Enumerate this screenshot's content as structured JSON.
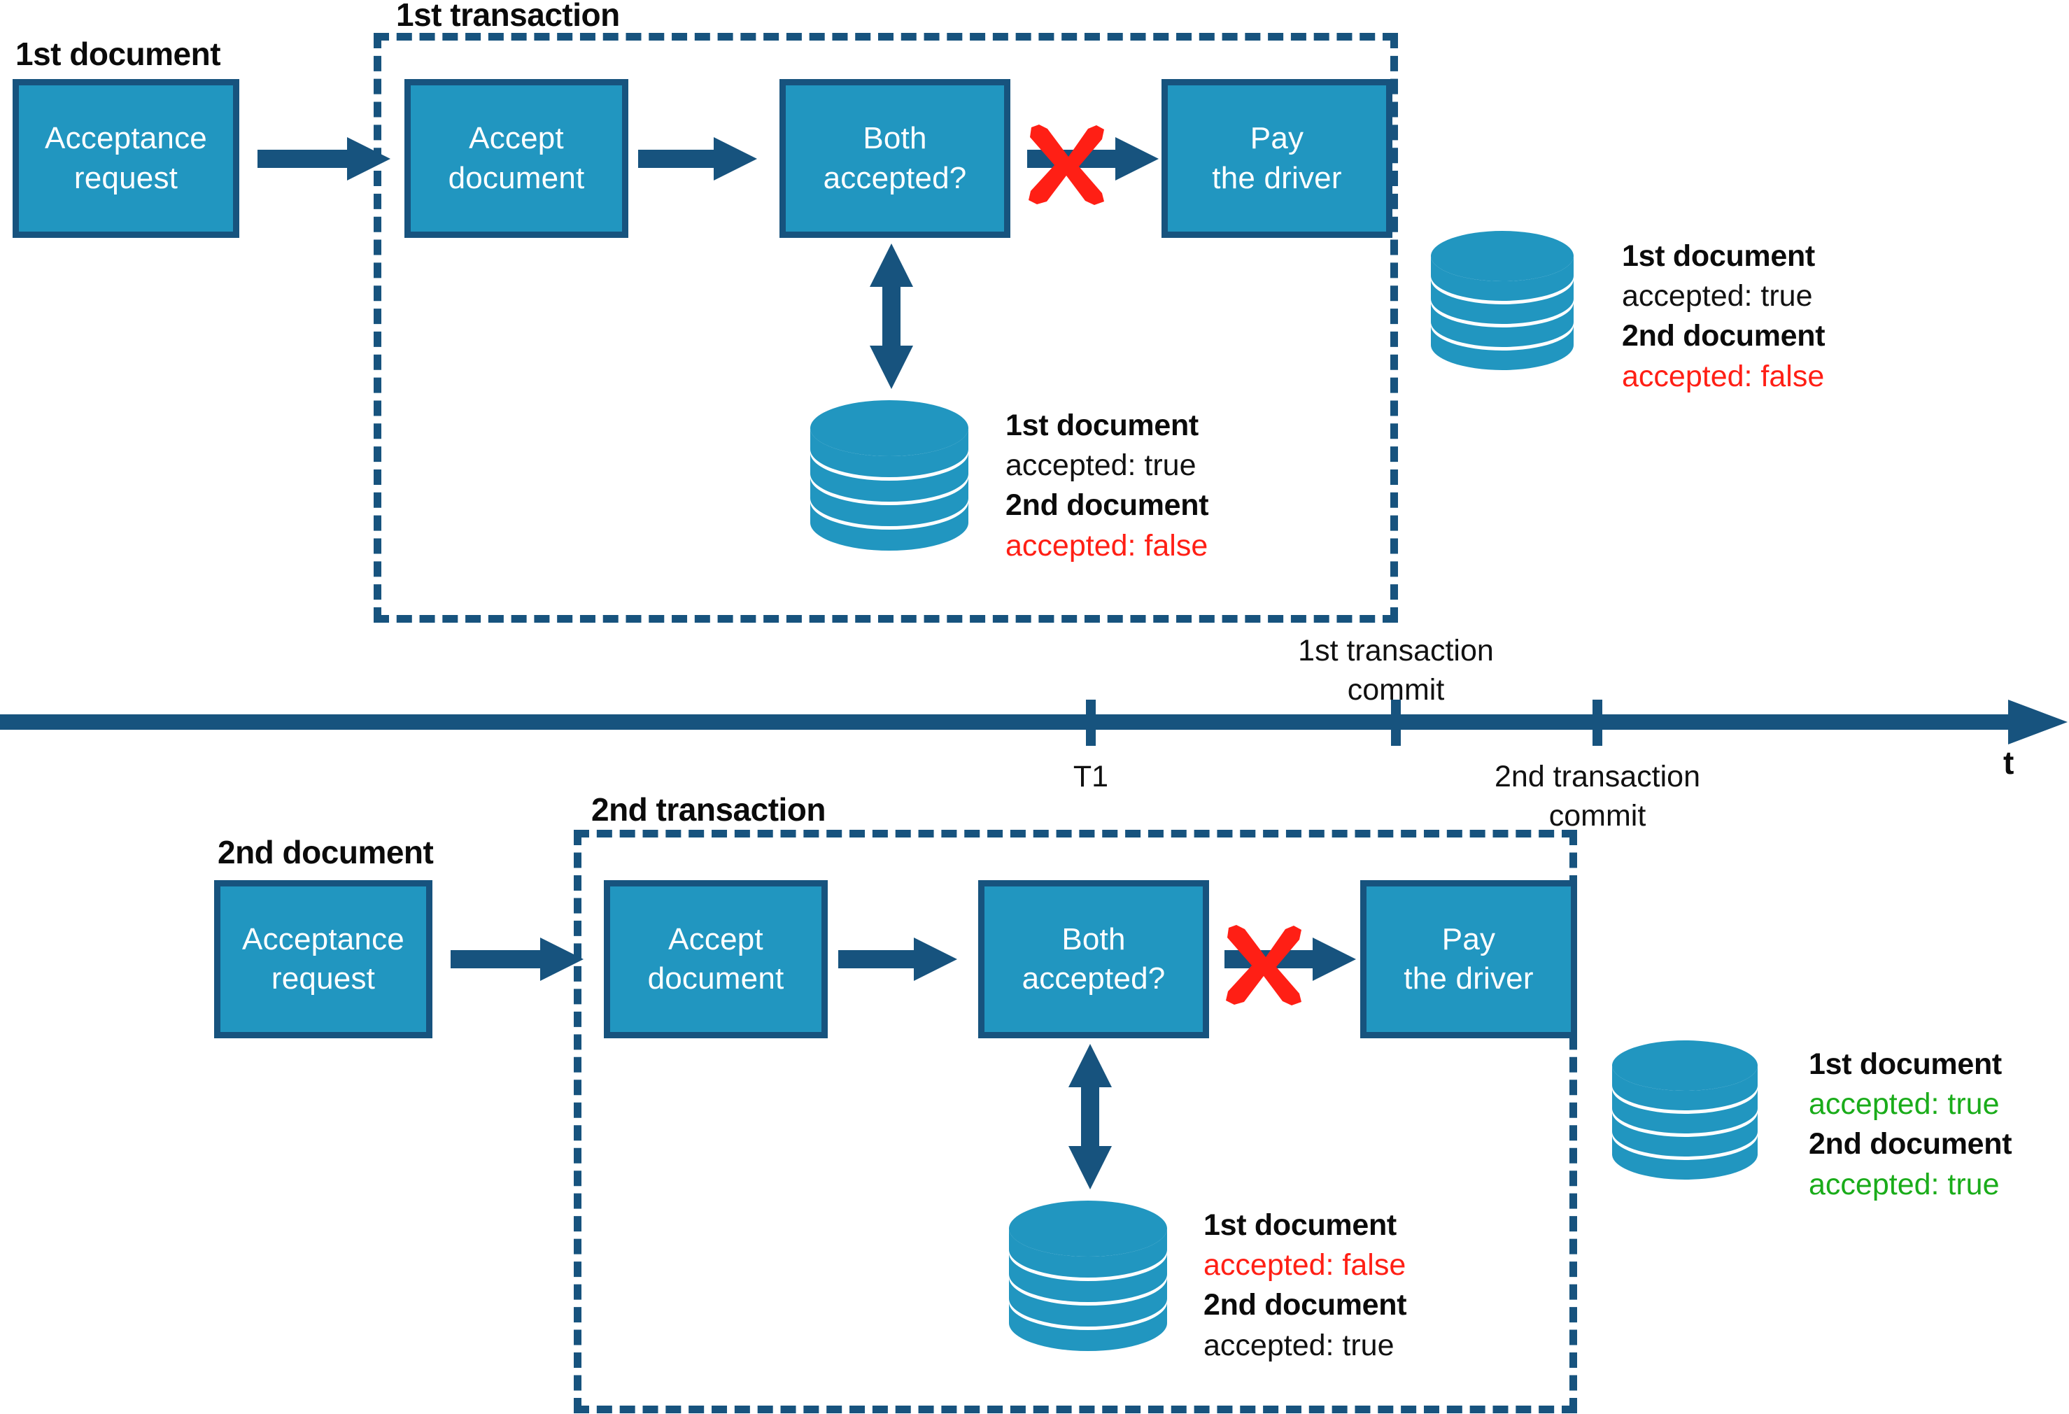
{
  "diagram": {
    "title_top_transaction": "1st transaction",
    "title_bottom_transaction": "2nd transaction",
    "label_first_document": "1st document",
    "label_second_document": "2nd document"
  },
  "colors": {
    "box_fill": "#2196c0",
    "box_border": "#17537e",
    "arrow": "#17537e",
    "database": "#2196c0",
    "cross": "#ff1f15",
    "true_text": "#1aac1a",
    "false_text": "#ff1f15",
    "text": "#111111"
  },
  "top_flow": {
    "source_label": "1st document",
    "steps": [
      {
        "line1": "Acceptance",
        "line2": "request"
      },
      {
        "line1": "Accept",
        "line2": "document"
      },
      {
        "line1": "Both",
        "line2": "accepted?"
      },
      {
        "line1": "Pay",
        "line2": "the driver"
      }
    ],
    "blocked_icon": "red-cross-icon"
  },
  "bottom_flow": {
    "source_label": "2nd document",
    "steps": [
      {
        "line1": "Acceptance",
        "line2": "request"
      },
      {
        "line1": "Accept",
        "line2": "document"
      },
      {
        "line1": "Both",
        "line2": "accepted?"
      },
      {
        "line1": "Pay",
        "line2": "the driver"
      }
    ],
    "blocked_icon": "red-cross-icon"
  },
  "databases": [
    {
      "id": "db-top-inner",
      "icon": "database-icon",
      "rows": [
        {
          "key": "1st document",
          "value": "accepted: true",
          "state": "neutral"
        },
        {
          "key": "2nd document",
          "value": "accepted: false",
          "state": "false"
        }
      ]
    },
    {
      "id": "db-top-after-commit",
      "icon": "database-icon",
      "rows": [
        {
          "key": "1st document",
          "value": "accepted: true",
          "state": "neutral"
        },
        {
          "key": "2nd document",
          "value": "accepted: false",
          "state": "false"
        }
      ]
    },
    {
      "id": "db-bottom-inner",
      "icon": "database-icon",
      "rows": [
        {
          "key": "1st document",
          "value": "accepted: false",
          "state": "false"
        },
        {
          "key": "2nd document",
          "value": "accepted: true",
          "state": "neutral"
        }
      ]
    },
    {
      "id": "db-bottom-after-commit",
      "icon": "database-icon",
      "rows": [
        {
          "key": "1st document",
          "value": "accepted: true",
          "state": "true"
        },
        {
          "key": "2nd document",
          "value": "accepted: true",
          "state": "true"
        }
      ]
    }
  ],
  "timeline": {
    "axis_label": "t",
    "ticks": [
      {
        "id": "tick-t1",
        "label": "T1",
        "label_line2": "",
        "position": "below"
      },
      {
        "id": "tick-c1",
        "label": "1st transaction",
        "label_line2": "commit",
        "position": "above"
      },
      {
        "id": "tick-c2",
        "label": "2nd transaction",
        "label_line2": "commit",
        "position": "below"
      }
    ]
  }
}
